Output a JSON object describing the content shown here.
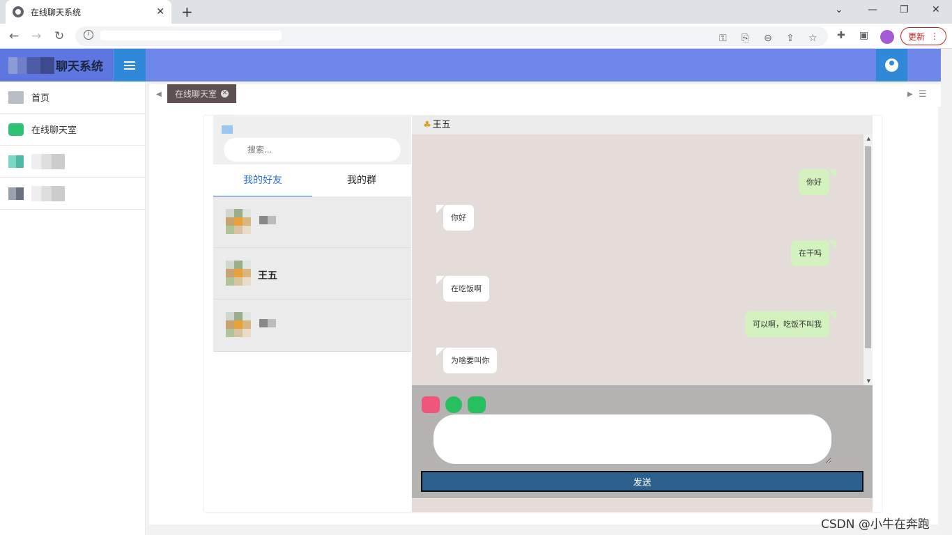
{
  "browser": {
    "tab_title": "在线聊天系统",
    "tab_close": "✕",
    "new_tab": "+",
    "update_label": "更新"
  },
  "header": {
    "app_title": "聊天系统"
  },
  "sidebar": {
    "items": [
      {
        "label": "首页",
        "icon": "mail-icon"
      },
      {
        "label": "在线聊天室",
        "icon": "chat-icon"
      },
      {
        "label": "",
        "icon": "blurred-icon"
      },
      {
        "label": "",
        "icon": "blurred-icon"
      }
    ]
  },
  "page_tabs": {
    "active_tab": "在线聊天室",
    "close": "✕"
  },
  "chat": {
    "search_placeholder": "搜索...",
    "tabs": [
      "我的好友",
      "我的群"
    ],
    "friends": [
      {
        "name": ""
      },
      {
        "name": "王五"
      },
      {
        "name": ""
      }
    ],
    "current_contact": "王五",
    "messages": [
      {
        "text": "你好",
        "side": "mine"
      },
      {
        "text": "你好",
        "side": "theirs"
      },
      {
        "text": "在干吗",
        "side": "mine"
      },
      {
        "text": "在吃饭啊",
        "side": "theirs"
      },
      {
        "text": "可以啊，吃饭不叫我",
        "side": "mine"
      },
      {
        "text": "为啥要叫你",
        "side": "theirs"
      }
    ],
    "send_label": "发送"
  },
  "watermark": "CSDN @小牛在奔跑"
}
